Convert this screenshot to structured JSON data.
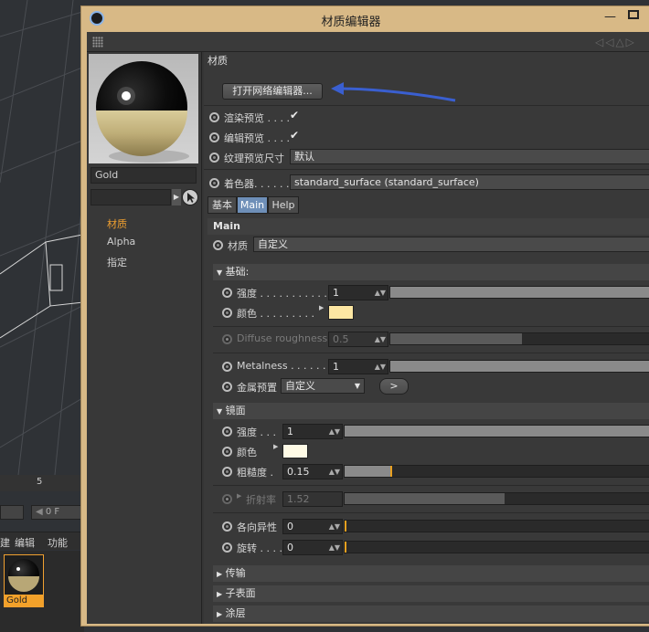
{
  "window": {
    "title": "材质编辑器"
  },
  "background": {
    "timeline_number": "5",
    "frame_value": "0 F",
    "menu": [
      "建",
      "编辑",
      "功能"
    ],
    "material_thumb_label": "Gold"
  },
  "leftpanel": {
    "material_name": "Gold",
    "channels": [
      "材质",
      "Alpha",
      "指定"
    ]
  },
  "right": {
    "section_title": "材质",
    "open_node_editor": "打开网络编辑器...",
    "render_preview_label": "渲染预览 . . . .",
    "editor_preview_label": "编辑预览 . . . .",
    "texture_preview_size_label": "纹理预览尺寸",
    "texture_preview_size_value": "默认",
    "shader_label": "着色器. . . . . .",
    "shader_value": "standard_surface (standard_surface)",
    "tabs": [
      "基本",
      "Main",
      "Help"
    ],
    "main_header": "Main",
    "material_label": "材质",
    "material_value": "自定义",
    "base": {
      "header": "基础:",
      "strength_label": "强度 . . . . . . . . . . . .",
      "strength_value": "1",
      "strength_fraction": 1.0,
      "color_label": "颜色 . . . . . . . . .",
      "color_hex": "#fde7a3",
      "diffuse_roughness_label": "Diffuse roughness",
      "diffuse_roughness_value": "0.5",
      "diffuse_roughness_fraction": 0.5,
      "metalness_label": "Metalness . . . . . . .",
      "metalness_value": "1",
      "metalness_fraction": 1.0,
      "metal_preset_label": "金属预置",
      "metal_preset_value": "自定义",
      "metal_preset_button": ">"
    },
    "specular": {
      "header": "镜面",
      "strength_label": "强度 . . .",
      "strength_value": "1",
      "strength_fraction": 1.0,
      "color_label": "颜色",
      "color_hex": "#fffbe6",
      "roughness_label": "粗糙度 .",
      "roughness_value": "0.15",
      "roughness_fraction": 0.15,
      "ior_label": "折射率",
      "ior_value": "1.52",
      "ior_fraction": 0.52,
      "anisotropy_label": "各向异性",
      "anisotropy_value": "0",
      "anisotropy_fraction": 0,
      "rotation_label": "旋转 . . . .",
      "rotation_value": "0",
      "rotation_fraction": 0
    },
    "collapsed": [
      "传输",
      "子表面",
      "涂层"
    ]
  },
  "colors": {
    "accent": "#f0a030",
    "window_frame": "#d8b986",
    "active_tab": "#6e8fb8",
    "arrow": "#3a5fd0"
  }
}
